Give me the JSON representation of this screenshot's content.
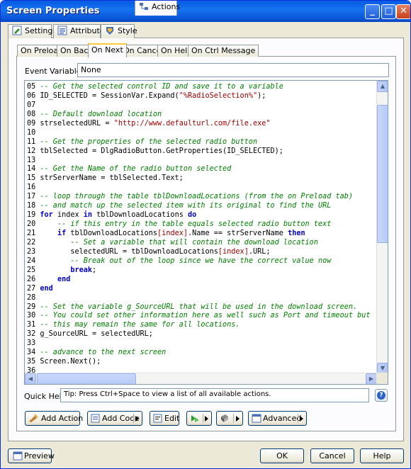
{
  "window": {
    "title": "Screen Properties"
  },
  "tabs": [
    {
      "label": "Settings",
      "icon": "settings-icon"
    },
    {
      "label": "Attributes",
      "icon": "attributes-icon"
    },
    {
      "label": "Style",
      "icon": "style-icon"
    },
    {
      "label": "Actions",
      "icon": "actions-icon",
      "active": true
    }
  ],
  "event_tabs": [
    {
      "label": "On Preload"
    },
    {
      "label": "On Back"
    },
    {
      "label": "On Next",
      "active": true
    },
    {
      "label": "On Cancel"
    },
    {
      "label": "On Help"
    },
    {
      "label": "On Ctrl Message"
    }
  ],
  "event_variables": {
    "label": "Event Variables:",
    "value": "None"
  },
  "code": [
    {
      "n": "05",
      "parts": [
        [
          "c",
          "-- Get the selected control ID and save it to a variable"
        ]
      ]
    },
    {
      "n": "06",
      "parts": [
        [
          "t",
          "ID_SELECTED = SessionVar.Expand("
        ],
        [
          "s",
          "\"%RadioSelection%\""
        ],
        [
          "t",
          ");"
        ]
      ]
    },
    {
      "n": "07",
      "parts": []
    },
    {
      "n": "08",
      "parts": [
        [
          "c",
          "-- Default download location"
        ]
      ]
    },
    {
      "n": "09",
      "parts": [
        [
          "t",
          "strselectedURL = "
        ],
        [
          "s",
          "\"http://www.defaulturl.com/file.exe\""
        ]
      ]
    },
    {
      "n": "10",
      "parts": []
    },
    {
      "n": "11",
      "parts": [
        [
          "c",
          "-- Get the properties of the selected radio button"
        ]
      ]
    },
    {
      "n": "12",
      "parts": [
        [
          "t",
          "tblSelected = DlgRadioButton.GetProperties(ID_SELECTED);"
        ]
      ]
    },
    {
      "n": "13",
      "parts": []
    },
    {
      "n": "14",
      "parts": [
        [
          "c",
          "-- Get the Name of the radio button selected"
        ]
      ]
    },
    {
      "n": "15",
      "parts": [
        [
          "t",
          "strServerName = tblSelected.Text;"
        ]
      ]
    },
    {
      "n": "16",
      "parts": []
    },
    {
      "n": "17",
      "parts": [
        [
          "c",
          "-- loop through the table tblDownloadLocations (from the on Preload tab)"
        ]
      ]
    },
    {
      "n": "18",
      "parts": [
        [
          "c",
          "-- and match up the selected item with its original to find the URL"
        ]
      ]
    },
    {
      "n": "19",
      "parts": [
        [
          "k",
          "for"
        ],
        [
          "t",
          " index "
        ],
        [
          "k",
          "in"
        ],
        [
          "t",
          " tblDownloadLocations "
        ],
        [
          "k",
          "do"
        ]
      ]
    },
    {
      "n": "20",
      "parts": [
        [
          "t",
          "    "
        ],
        [
          "c",
          "-- if this entry in the table equals selected radio button text"
        ]
      ]
    },
    {
      "n": "21",
      "parts": [
        [
          "t",
          "    "
        ],
        [
          "k",
          "if"
        ],
        [
          "t",
          " tblDownloadLocations"
        ],
        [
          "r",
          "[index]"
        ],
        [
          "t",
          ".Name == strServerName "
        ],
        [
          "k",
          "then"
        ]
      ]
    },
    {
      "n": "22",
      "parts": [
        [
          "t",
          "       "
        ],
        [
          "c",
          "-- Set a variable that will contain the download location"
        ]
      ]
    },
    {
      "n": "23",
      "parts": [
        [
          "t",
          "       selectedURL = tblDownloadLocations"
        ],
        [
          "r",
          "[index]"
        ],
        [
          "t",
          ".URL;"
        ]
      ]
    },
    {
      "n": "24",
      "parts": [
        [
          "t",
          "       "
        ],
        [
          "c",
          "-- Break out of the loop since we have the correct value now"
        ]
      ]
    },
    {
      "n": "25",
      "parts": [
        [
          "t",
          "       "
        ],
        [
          "k",
          "break"
        ],
        [
          "t",
          ";"
        ]
      ]
    },
    {
      "n": "26",
      "parts": [
        [
          "t",
          "    "
        ],
        [
          "k",
          "end"
        ]
      ]
    },
    {
      "n": "27",
      "parts": [
        [
          "k",
          "end"
        ]
      ]
    },
    {
      "n": "28",
      "parts": []
    },
    {
      "n": "29",
      "parts": [
        [
          "c",
          "-- Set the variable g_SourceURL that will be used in the download screen."
        ]
      ]
    },
    {
      "n": "30",
      "parts": [
        [
          "c",
          "-- You could set other information here as well such as Port and timeout but"
        ]
      ]
    },
    {
      "n": "31",
      "parts": [
        [
          "c",
          "-- this may remain the same for all locations."
        ]
      ]
    },
    {
      "n": "32",
      "parts": [
        [
          "t",
          "g_SourceURL = selectedURL;"
        ]
      ]
    },
    {
      "n": "33",
      "parts": []
    },
    {
      "n": "34",
      "parts": [
        [
          "c",
          "-- advance to the next screen"
        ]
      ]
    },
    {
      "n": "35",
      "parts": [
        [
          "t",
          "Screen.Next();"
        ]
      ]
    },
    {
      "n": "36",
      "parts": []
    }
  ],
  "quick_help": {
    "label": "Quick Help:",
    "value": "Tip: Press Ctrl+Space to view a list of all available actions."
  },
  "action_buttons": {
    "add_action": "Add Action",
    "add_code": "Add Code",
    "edit": "Edit",
    "advanced": "Advanced"
  },
  "footer": {
    "preview": "Preview",
    "ok": "OK",
    "cancel": "Cancel",
    "help": "Help"
  },
  "colors": {
    "comment": "#008000",
    "string": "#a00000",
    "keyword": "#0000cc",
    "titlebar": "#0a5ce6"
  }
}
